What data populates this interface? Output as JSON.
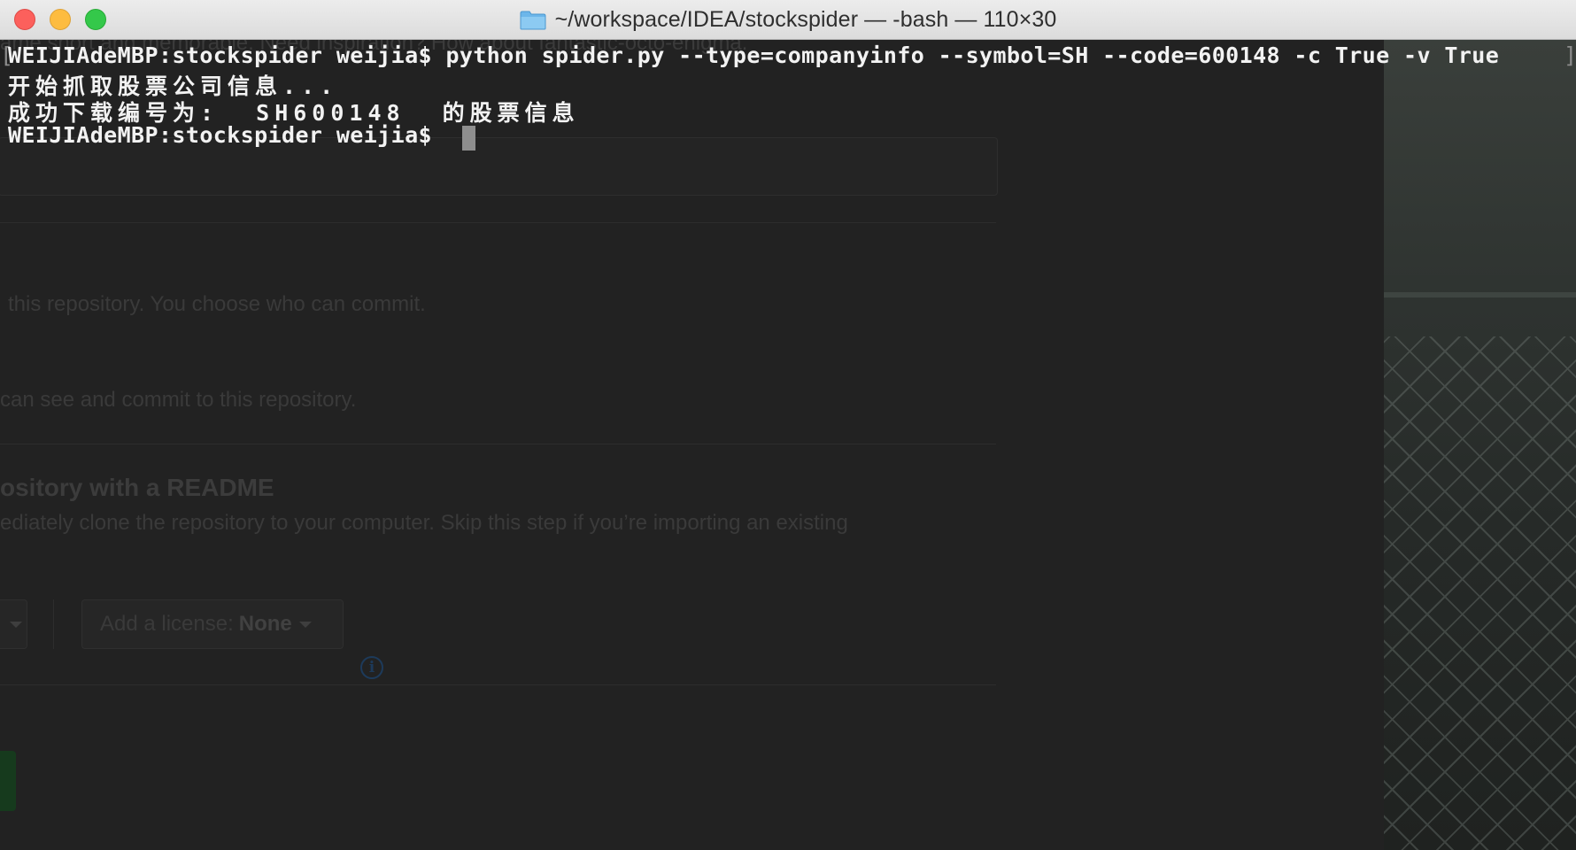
{
  "window": {
    "title": "~/workspace/IDEA/stockspider — -bash — 110×30",
    "icon": "folder-icon"
  },
  "terminal": {
    "lines": [
      "WEIJIAdeMBP:stockspider weijia$ python spider.py --type=companyinfo --symbol=SH --code=600148 -c True -v True",
      "开始抓取股票公司信息...",
      "成功下载编号为:  SH600148  的股票信息",
      "WEIJIAdeMBP:stockspider weijia$ "
    ],
    "left_bracket": "[",
    "right_bracket": "]"
  },
  "background_page": {
    "top_fragment": "ame short and memorable. Need inspiration? How about fantastic-octo-enigma.",
    "text_1": "this repository. You choose who can commit.",
    "text_2": "can see and commit to this repository.",
    "heading": "ository with a README",
    "text_3": "ediately clone the repository to your computer. Skip this step if you’re importing an existing",
    "license_label": "Add a license:",
    "license_value": "None",
    "info_glyph": "i"
  },
  "colors": {
    "terminal_bg": "#222222",
    "terminal_text": "#f2f2f2",
    "cursor": "#8e8e8e"
  }
}
